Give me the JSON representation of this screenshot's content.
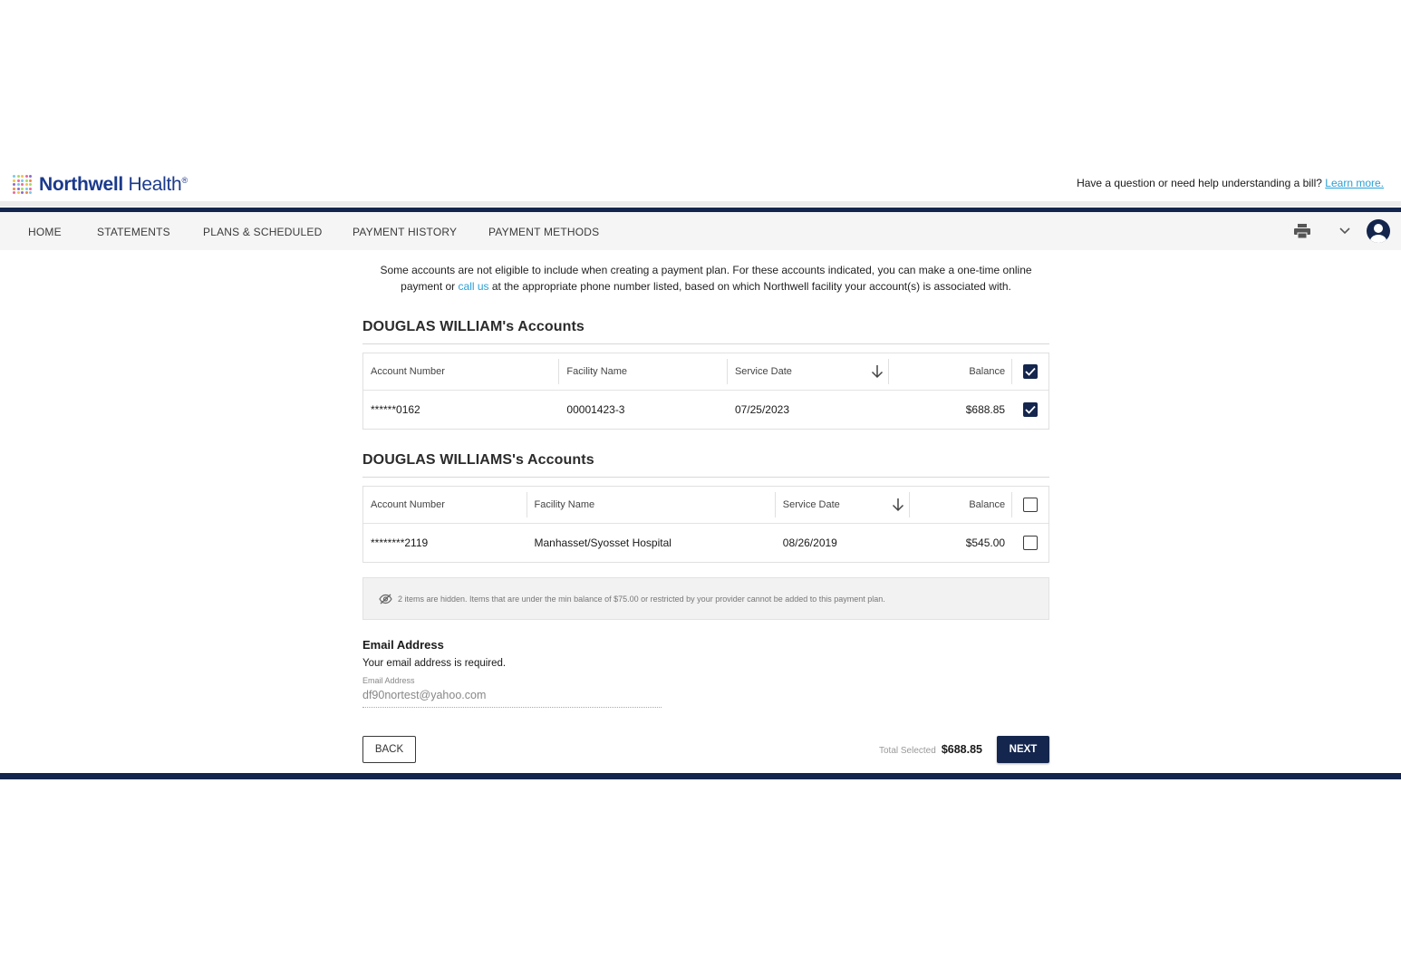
{
  "header": {
    "logo_bold": "Northwell",
    "logo_light": "Health",
    "logo_reg": "®",
    "help_text": "Have a question or need help understanding a bill?",
    "help_link": "Learn more."
  },
  "nav": {
    "items": [
      {
        "label": "HOME"
      },
      {
        "label": "STATEMENTS"
      },
      {
        "label": "PLANS & SCHEDULED"
      },
      {
        "label": "PAYMENT HISTORY"
      },
      {
        "label": "PAYMENT METHODS"
      }
    ]
  },
  "notice": {
    "part1": "Some accounts are not eligible to include when creating a payment plan. For these accounts indicated, you can make a one-time online payment or ",
    "link": "call us",
    "part2": " at the appropriate phone number listed, based on which Northwell facility your account(s) is associated with."
  },
  "groups": [
    {
      "title": "DOUGLAS WILLIAM's Accounts",
      "headers": {
        "account": "Account Number",
        "facility": "Facility Name",
        "date": "Service Date",
        "balance": "Balance"
      },
      "header_checked": true,
      "rows": [
        {
          "account": "******0162",
          "facility": "00001423-3",
          "date": "07/25/2023",
          "balance": "$688.85",
          "checked": true
        }
      ]
    },
    {
      "title": "DOUGLAS WILLIAMS's Accounts",
      "headers": {
        "account": "Account Number",
        "facility": "Facility Name",
        "date": "Service Date",
        "balance": "Balance"
      },
      "header_checked": false,
      "rows": [
        {
          "account": "********2119",
          "facility": "Manhasset/Syosset Hospital",
          "date": "08/26/2019",
          "balance": "$545.00",
          "checked": false
        }
      ]
    }
  ],
  "hidden_note": "2 items are hidden. Items that are under the min balance of $75.00 or restricted by your provider cannot be added to this payment plan.",
  "email": {
    "title": "Email Address",
    "required": "Your email address is required.",
    "label": "Email Address",
    "value": "df90nortest@yahoo.com"
  },
  "footer": {
    "back_label": "BACK",
    "total_label": "Total Selected",
    "total_value": "$688.85",
    "next_label": "NEXT"
  },
  "colors": {
    "navy": "#14264d",
    "link": "#2a9fd6",
    "brand": "#1b3a8c"
  }
}
